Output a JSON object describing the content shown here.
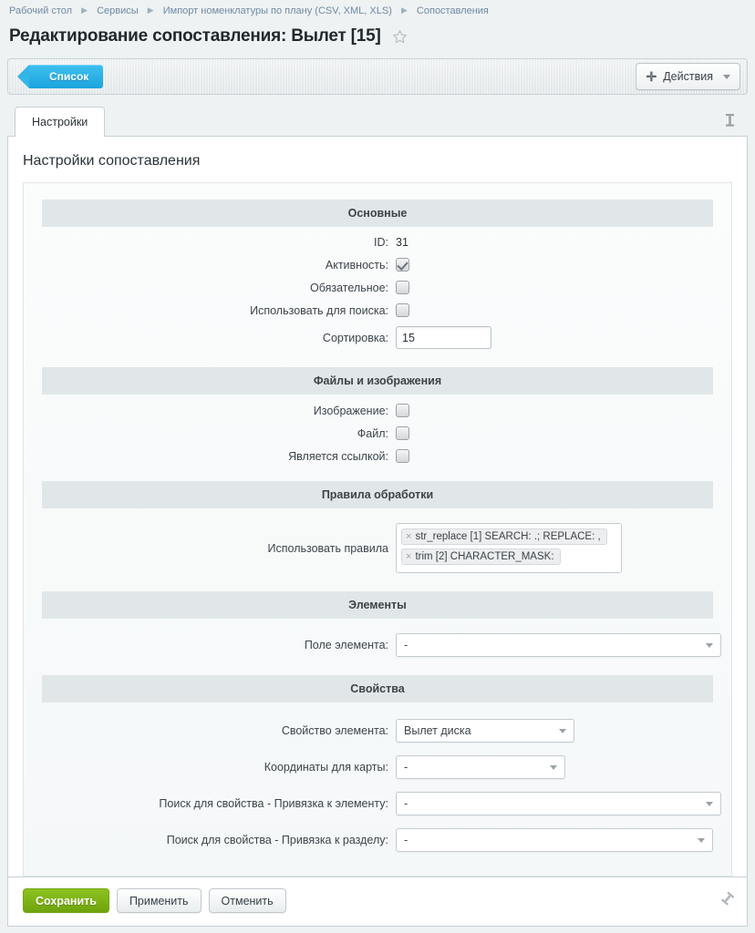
{
  "breadcrumb": {
    "items": [
      {
        "label": "Рабочий стол"
      },
      {
        "label": "Сервисы"
      },
      {
        "label": "Импорт номенклатуры по плану (CSV, XML, XLS)"
      },
      {
        "label": "Сопоставления"
      }
    ]
  },
  "header": {
    "title": "Редактирование сопоставления: Вылет [15]",
    "star_icon": "star-outline-icon"
  },
  "toolbar": {
    "back_label": "Список",
    "actions_label": "Действия",
    "plus_icon": "plus-icon",
    "caret_icon": "chevron-down-icon"
  },
  "tabs": {
    "items": [
      {
        "label": "Настройки",
        "active": true
      }
    ],
    "pin_icon": "pin-icon"
  },
  "panel": {
    "title": "Настройки сопоставления"
  },
  "sections": {
    "main": {
      "heading": "Основные",
      "id_label": "ID:",
      "id_value": "31",
      "active_label": "Активность:",
      "active_checked": true,
      "required_label": "Обязательное:",
      "required_checked": false,
      "search_label": "Использовать для поиска:",
      "search_checked": false,
      "sort_label": "Сортировка:",
      "sort_value": "15"
    },
    "files": {
      "heading": "Файлы и изображения",
      "image_label": "Изображение:",
      "image_checked": false,
      "file_label": "Файл:",
      "file_checked": false,
      "islink_label": "Является ссылкой:",
      "islink_checked": false
    },
    "rules": {
      "heading": "Правила обработки",
      "use_rules_label": "Использовать правила",
      "tags": [
        {
          "remove_icon": "×",
          "label": "str_replace [1] SEARCH: .; REPLACE: ,"
        },
        {
          "remove_icon": "×",
          "label": "trim [2] CHARACTER_MASK:"
        }
      ]
    },
    "elements": {
      "heading": "Элементы",
      "field_label": "Поле элемента:",
      "field_value": "-"
    },
    "properties": {
      "heading": "Свойства",
      "prop_label": "Свойство элемента:",
      "prop_value": "Вылет диска",
      "coords_label": "Координаты для карты:",
      "coords_value": "-",
      "search_elem_label": "Поиск для свойства - Привязка к элементу:",
      "search_elem_value": "-",
      "search_sect_label": "Поиск для свойства - Привязка к разделу:",
      "search_sect_value": "-"
    }
  },
  "footer": {
    "save_label": "Сохранить",
    "apply_label": "Применить",
    "cancel_label": "Отменить",
    "pin_icon": "pin-icon"
  },
  "colors": {
    "accent_blue": "#1ba4de",
    "save_green": "#7fb315",
    "section_header": "#e1e7e8",
    "breadcrumb_text": "#7089a4"
  }
}
